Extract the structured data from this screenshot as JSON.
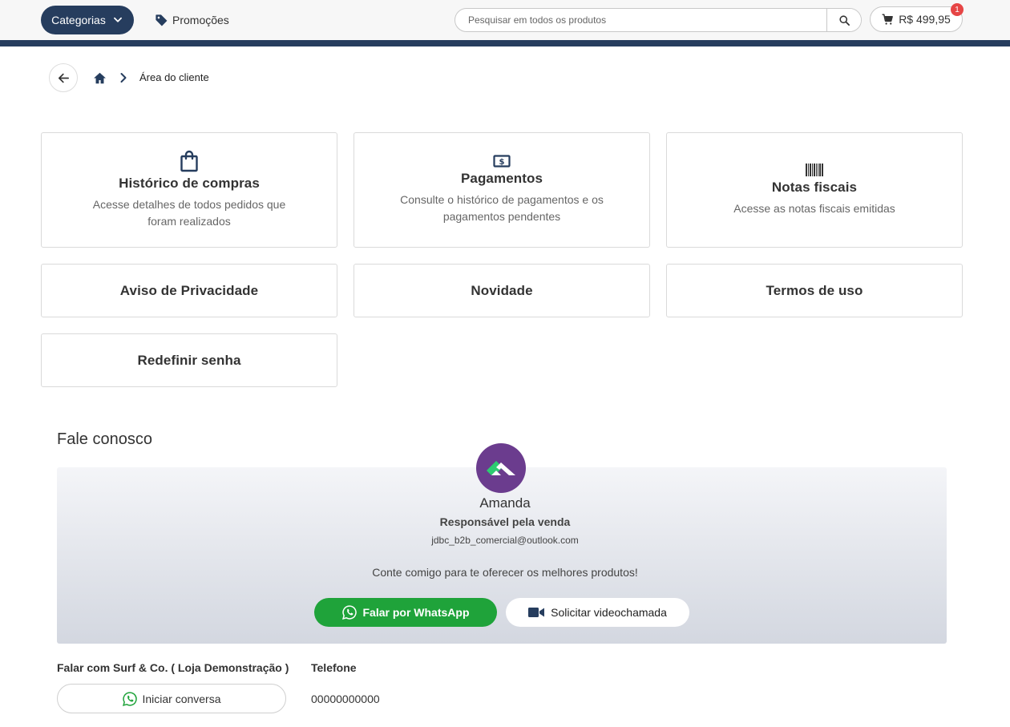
{
  "header": {
    "categories_label": "Categorias",
    "promotions_label": "Promoções",
    "search_placeholder": "Pesquisar em todos os produtos",
    "cart_total": "R$ 499,95",
    "cart_count": "1"
  },
  "breadcrumb": {
    "current": "Área do cliente"
  },
  "cards": {
    "purchases": {
      "title": "Histórico de compras",
      "desc": "Acesse detalhes de todos pedidos que foram realizados"
    },
    "payments": {
      "title": "Pagamentos",
      "desc": "Consulte o histórico de pagamentos e os pagamentos pendentes"
    },
    "invoices": {
      "title": "Notas fiscais",
      "desc": "Acesse as notas fiscais emitidas"
    },
    "privacy": {
      "title": "Aviso de Privacidade"
    },
    "news": {
      "title": "Novidade"
    },
    "terms": {
      "title": "Termos de uso"
    },
    "password": {
      "title": "Redefinir senha"
    }
  },
  "contact": {
    "section_title": "Fale conosco",
    "agent_name": "Amanda",
    "agent_role": "Responsável pela venda",
    "agent_email": "jdbc_b2b_comercial@outlook.com",
    "message": "Conte comigo para te oferecer os melhores produtos!",
    "whatsapp_label": "Falar por WhatsApp",
    "video_label": "Solicitar videochamada",
    "store_label": "Falar com Surf & Co. ( Loja Demonstração )",
    "start_chat_label": "Iniciar conversa",
    "phone_label": "Telefone",
    "phone_value": "00000000000"
  },
  "colors": {
    "primary": "#263d5e",
    "whatsapp": "#1fa33a",
    "avatar": "#6b3c8e",
    "badge": "#e64545"
  }
}
